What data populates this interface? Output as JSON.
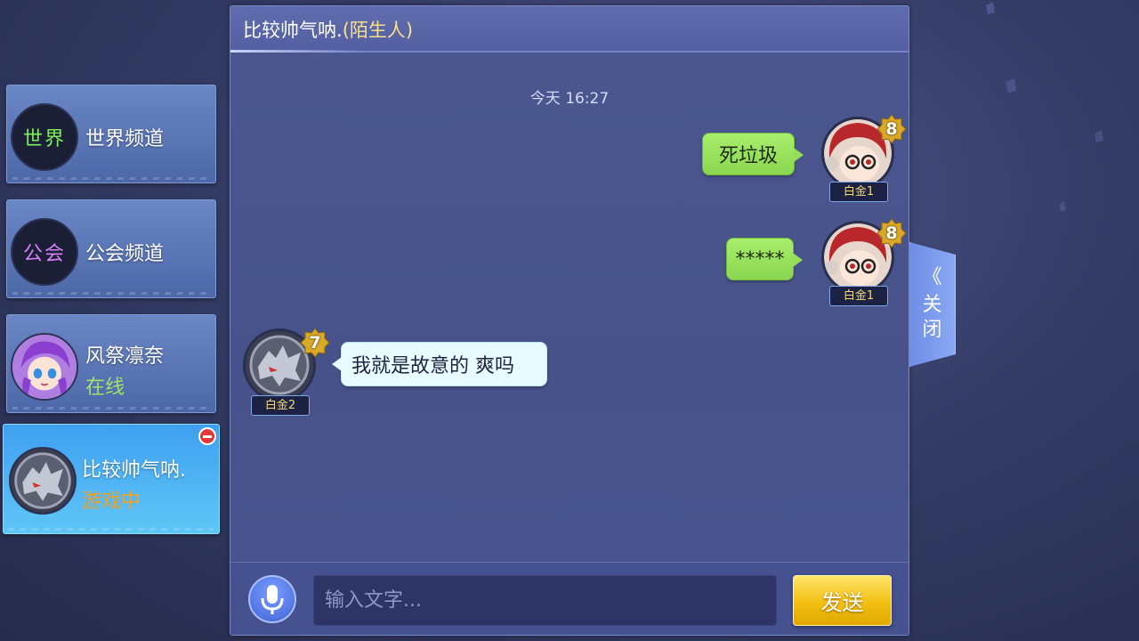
{
  "sidebar": {
    "items": [
      {
        "badge": "世界",
        "label": "世界频道"
      },
      {
        "badge": "公会",
        "label": "公会频道"
      },
      {
        "name": "风祭凛奈",
        "status": "在线"
      },
      {
        "name": "比较帅气呐.",
        "status": "游戏中"
      }
    ]
  },
  "chat": {
    "title": "比较帅气呐.",
    "title_tag": "(陌生人)",
    "timestamp": "今天 16:27",
    "messages": [
      {
        "text": "死垃圾",
        "level": "8",
        "rank": "白金1",
        "side": "self"
      },
      {
        "text": "*****",
        "level": "8",
        "rank": "白金1",
        "side": "self"
      },
      {
        "text": "我就是故意的 爽吗",
        "level": "7",
        "rank": "白金2",
        "side": "other"
      }
    ]
  },
  "input": {
    "placeholder": "输入文字...",
    "send_label": "发送"
  },
  "close_tab": {
    "chevron": "《",
    "label_line1": "关",
    "label_line2": "闭"
  },
  "colors": {
    "bg": "#343c66",
    "panel": "#4c5790",
    "bubble_self": "#96de5a",
    "bubble_other": "#e8fbff",
    "send_button": "#f2bf12",
    "status_online": "#9ee46a",
    "status_ingame": "#f4a020"
  },
  "icons": [
    "microphone-icon",
    "remove-friend-icon",
    "chevron-left-icon"
  ]
}
